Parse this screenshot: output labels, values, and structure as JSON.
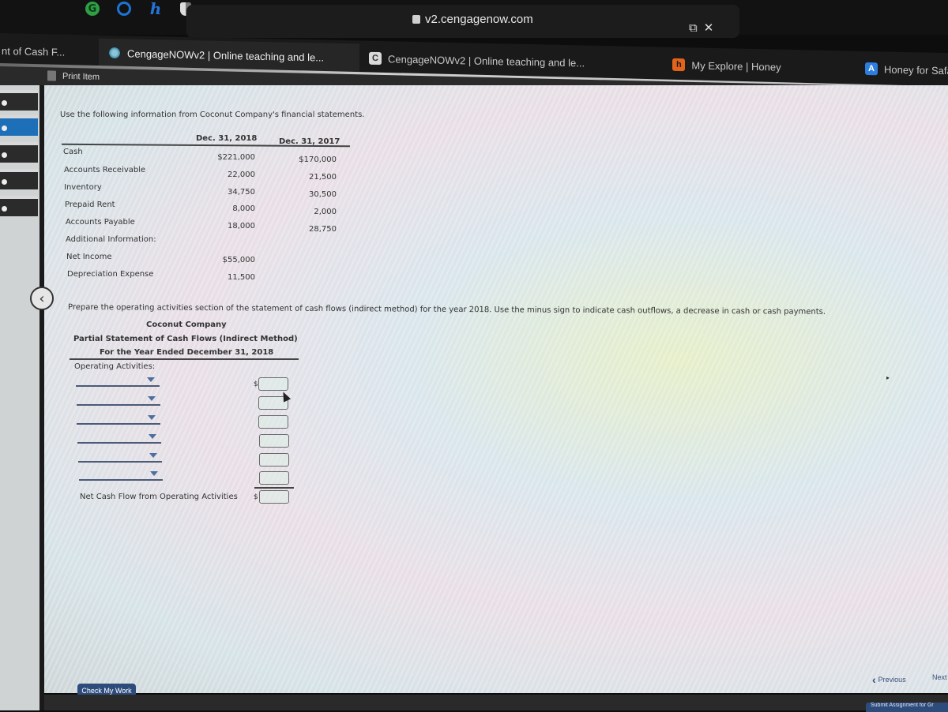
{
  "browser": {
    "extensions": [
      {
        "name": "grammarly",
        "glyph": "G"
      },
      {
        "name": "adblock",
        "glyph": "⊘"
      },
      {
        "name": "honey",
        "glyph": "h"
      },
      {
        "name": "privacy-shield",
        "glyph": ""
      }
    ],
    "url": "v2.cengagenow.com",
    "tabs": [
      {
        "label": "nt of Cash F...",
        "icon": ""
      },
      {
        "label": "CengageNOWv2 | Online teaching and le...",
        "icon": "cengage"
      },
      {
        "label": "CengageNOWv2 | Online teaching and le...",
        "icon": "C"
      },
      {
        "label": "My Explore | Honey",
        "icon": "h"
      },
      {
        "label": "Honey for Safari",
        "icon": "A"
      }
    ]
  },
  "toolbar": {
    "print_label": "Print Item"
  },
  "sidebar": {
    "items": [
      {
        "active": false
      },
      {
        "active": true
      },
      {
        "active": false
      },
      {
        "active": false
      },
      {
        "active": false
      }
    ]
  },
  "problem": {
    "intro": "Use the following information from Coconut Company's financial statements.",
    "col_headers": [
      "Dec. 31, 2018",
      "Dec. 31, 2017"
    ],
    "rows": [
      {
        "label": "Cash",
        "y2018": "$221,000",
        "y2017": "$170,000"
      },
      {
        "label": "Accounts Receivable",
        "y2018": "22,000",
        "y2017": "21,500"
      },
      {
        "label": "Inventory",
        "y2018": "34,750",
        "y2017": "30,500"
      },
      {
        "label": "Prepaid Rent",
        "y2018": "8,000",
        "y2017": "2,000"
      },
      {
        "label": "Accounts Payable",
        "y2018": "18,000",
        "y2017": "28,750"
      }
    ],
    "additional_label": "Additional Information:",
    "additional": [
      {
        "label": "Net Income",
        "value": "$55,000"
      },
      {
        "label": "Depreciation Expense",
        "value": "11,500"
      }
    ],
    "instruction": "Prepare the operating activities section of the statement of cash flows (indirect method) for the year 2018. Use the minus sign to indicate cash outflows, a decrease in cash or cash payments."
  },
  "statement": {
    "company": "Coconut Company",
    "title": "Partial Statement of Cash Flows (Indirect Method)",
    "period": "For the Year Ended December 31, 2018",
    "section_label": "Operating Activities:",
    "line_items": [
      {
        "selected": "",
        "amount": "",
        "currency": "$"
      },
      {
        "selected": "",
        "amount": "",
        "currency": ""
      },
      {
        "selected": "",
        "amount": "",
        "currency": ""
      },
      {
        "selected": "",
        "amount": "",
        "currency": ""
      },
      {
        "selected": "",
        "amount": "",
        "currency": ""
      },
      {
        "selected": "",
        "amount": "",
        "currency": ""
      }
    ],
    "net_label": "Net Cash Flow from Operating Activities",
    "net_currency": "$",
    "net_amount": ""
  },
  "footer": {
    "check_label": "Check My Work",
    "previous_label": "Previous",
    "next_label": "Next",
    "submit_label": "Submit Assignment for Gr"
  }
}
